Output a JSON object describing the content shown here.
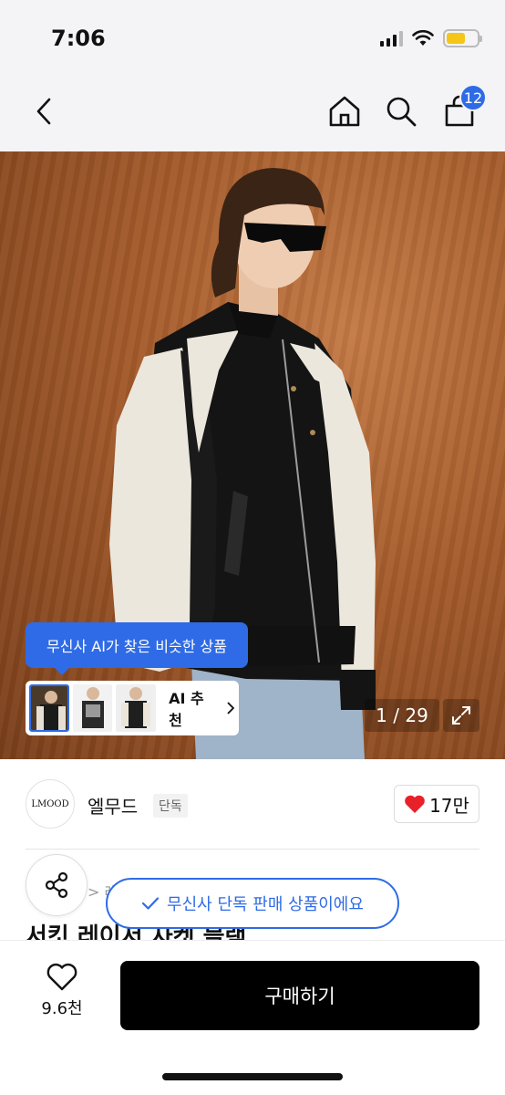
{
  "status_bar": {
    "time": "7:06"
  },
  "nav": {
    "cart_count": "12"
  },
  "colors": {
    "accent": "#2f6be6",
    "buy_button": "#000000",
    "heart": "#e8202a",
    "battery": "#f5c518"
  },
  "gallery": {
    "ai_tooltip": "무신사 AI가 찾은 비슷한 상품",
    "ai_recommend_label": "AI 추천",
    "counter": "1 / 29"
  },
  "brand": {
    "logo_text": "LMOOD",
    "name": "엘무드",
    "tag": "단독",
    "like_count": "17만"
  },
  "product": {
    "breadcrumb_partial": "> 레",
    "exclusive_notice": "무신사 단독 판매 상품이에요",
    "title": "서킷 레이서 자켓 블랙"
  },
  "purchase_bar": {
    "wish_count": "9.6천",
    "buy_label": "구매하기"
  }
}
